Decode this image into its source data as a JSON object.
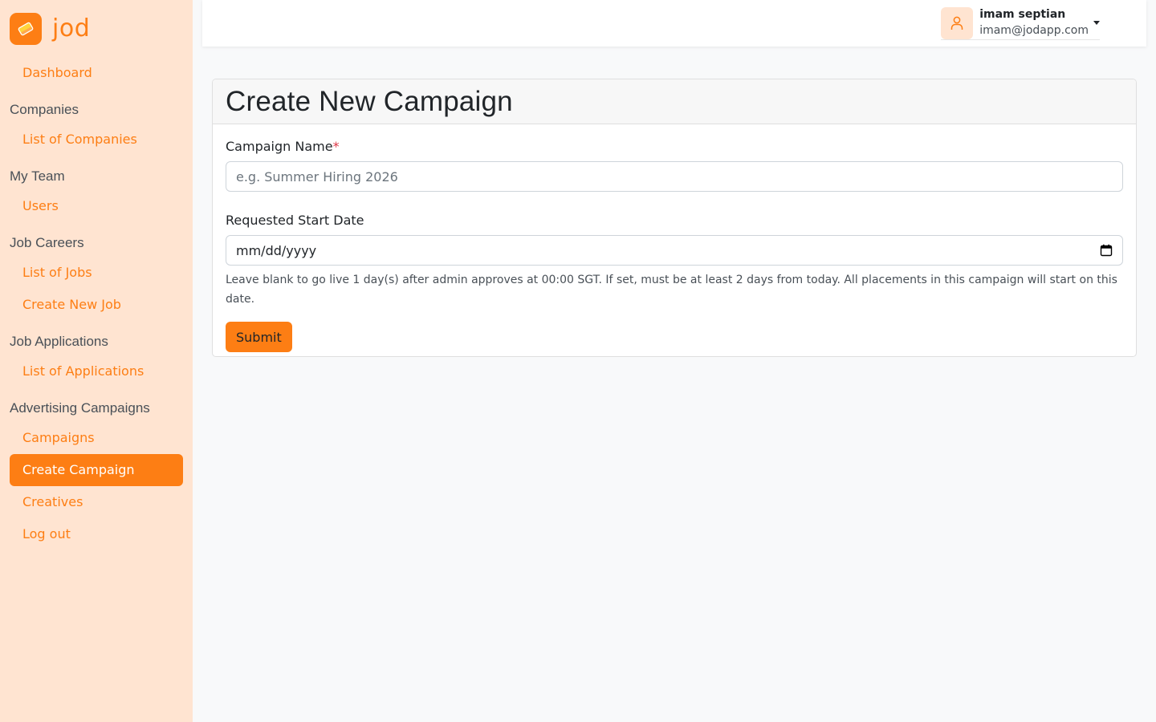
{
  "brand": {
    "name": "jod",
    "color": "#fd7e14"
  },
  "sidebar": {
    "dashboard": "Dashboard",
    "sections": [
      {
        "title": "Companies",
        "items": [
          "List of Companies"
        ]
      },
      {
        "title": "My Team",
        "items": [
          "Users"
        ]
      },
      {
        "title": "Job Careers",
        "items": [
          "List of Jobs",
          "Create New Job"
        ]
      },
      {
        "title": "Job Applications",
        "items": [
          "List of Applications"
        ]
      },
      {
        "title": "Advertising Campaigns",
        "items": [
          "Campaigns",
          "Create Campaign",
          "Creatives"
        ]
      }
    ],
    "active_item": "Create Campaign",
    "logout": "Log out"
  },
  "user": {
    "name": "imam septian",
    "email": "imam@jodapp.com",
    "avatar_icon": "user-icon"
  },
  "form": {
    "title": "Create New Campaign",
    "campaign_name_label": "Campaign Name",
    "required_marker": "*",
    "campaign_name_placeholder": "e.g. Summer Hiring 2026",
    "start_date_label": "Requested Start Date",
    "start_date_placeholder": "mm/dd/yyyy",
    "start_date_help": "Leave blank to go live 1 day(s) after admin approves at 00:00 SGT. If set, must be at least 2 days from today. All placements in this campaign will start on this date.",
    "submit_label": "Submit"
  }
}
